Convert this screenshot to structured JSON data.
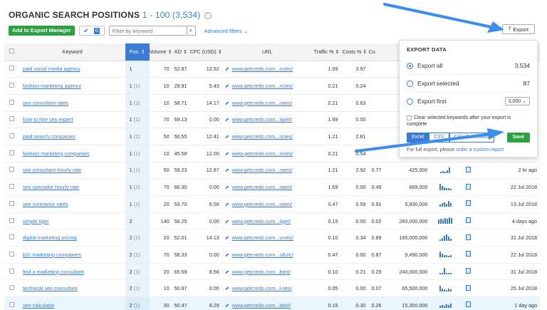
{
  "header": {
    "title": "ORGANIC SEARCH POSITIONS",
    "range": "1 - 100 (3,534)",
    "info_icon": "info-icon"
  },
  "toolbar": {
    "add_button": "Add to Export Manager",
    "check_count": "0",
    "filter_placeholder": "Filter by keyword",
    "advanced_filters": "Advanced filters"
  },
  "export_button": "Export",
  "columns": {
    "keyword": "Keyword",
    "pos": "Pos.",
    "volume": "Volume",
    "kd": "KD",
    "cpc": "CPC (USD)",
    "url": "URL",
    "traffic": "Traffic %",
    "costs": "Costs %",
    "com": "Co"
  },
  "rows": [
    {
      "keyword": "paid social media agency",
      "pos": "1",
      "prev": "",
      "volume": "70",
      "kd": "52.87",
      "cpc": "12.52",
      "url": "www.getcredo.com...ncies/",
      "traffic": "1.69",
      "costs": "3.97",
      "com": "",
      "results": "",
      "updated": "",
      "trend": []
    },
    {
      "keyword": "fashion marketing agency",
      "pos": "1",
      "prev": "(1)",
      "volume": "10",
      "kd": "29.91",
      "cpc": "5.43",
      "url": "www.getcredo.com...ncies/",
      "traffic": "0.21",
      "costs": "0.24",
      "com": "",
      "results": "",
      "updated": "",
      "trend": []
    },
    {
      "keyword": "seo consultant rates",
      "pos": "1",
      "prev": "(1)",
      "volume": "10",
      "kd": "58.71",
      "cpc": "14.17",
      "url": "www.getcredo.com...rates/",
      "traffic": "0.21",
      "costs": "0.63",
      "com": "",
      "results": "",
      "updated": "",
      "trend": []
    },
    {
      "keyword": "how to hire seo expert",
      "pos": "1",
      "prev": "(1)",
      "volume": "70",
      "kd": "69.13",
      "cpc": "0.00",
      "url": "www.getcredo.com...xpert/",
      "traffic": "1.69",
      "costs": "0.00",
      "com": "",
      "results": "",
      "updated": "",
      "trend": []
    },
    {
      "keyword": "paid search companies",
      "pos": "1",
      "prev": "(1)",
      "volume": "50",
      "kd": "50.55",
      "cpc": "12.41",
      "url": "www.getcredo.com...ncies/",
      "traffic": "1.21",
      "costs": "2.81",
      "com": "",
      "results": "",
      "updated": "",
      "trend": []
    },
    {
      "keyword": "fashion marketing companies",
      "pos": "1",
      "prev": "(1)",
      "volume": "10",
      "kd": "45.58",
      "cpc": "12.00",
      "url": "www.getcredo.com...ncies/",
      "traffic": "0.21",
      "costs": "0.54",
      "com": "",
      "results": "",
      "updated": "",
      "trend": []
    },
    {
      "keyword": "seo consultant hourly rate",
      "pos": "1",
      "prev": "(1)",
      "volume": "50",
      "kd": "59.23",
      "cpc": "12.87",
      "url": "www.getcredo.com...rates/",
      "traffic": "1.21",
      "costs": "2.92",
      "com": "0.77",
      "results": "425,000",
      "updated": "2 hr ago",
      "trend": [
        2,
        3,
        2,
        4,
        8
      ]
    },
    {
      "keyword": "seo specialist hourly rate",
      "pos": "1",
      "prev": "(1)",
      "volume": "70",
      "kd": "66.30",
      "cpc": "0.00",
      "url": "www.getcredo.com...rates/",
      "traffic": "1.69",
      "costs": "0.00",
      "com": "0.49",
      "results": "669,000",
      "updated": "22 Jul 2018",
      "trend": [
        9,
        6,
        4,
        3,
        3,
        2
      ]
    },
    {
      "keyword": "seo contractor rates",
      "pos": "1",
      "prev": "(1)",
      "volume": "20",
      "kd": "53.70",
      "cpc": "6.56",
      "url": "www.getcredo.com...rates/",
      "traffic": "0.47",
      "costs": "0.59",
      "com": "0.91",
      "results": "5,930,000",
      "updated": "13 Jul 2018",
      "trend": [
        3,
        5,
        6,
        4,
        8,
        5
      ]
    },
    {
      "keyword": "simple tiger",
      "pos": "2",
      "prev": "",
      "volume": "140",
      "kd": "56.25",
      "cpc": "0.00",
      "url": "www.getcredo.com...tiger/",
      "traffic": "0.15",
      "costs": "0.00",
      "com": "0.02",
      "results": "283,000,000",
      "updated": "4 days ago",
      "trend": [
        6,
        7,
        6,
        8,
        7,
        9,
        8
      ]
    },
    {
      "keyword": "digital marketing pricing",
      "pos": "2",
      "prev": "(1)",
      "volume": "20",
      "kd": "52.01",
      "cpc": "14.13",
      "url": "www.getcredo.com...urvey/",
      "traffic": "0.10",
      "costs": "0.34",
      "com": "0.89",
      "results": "165,000,000",
      "updated": "31 Jul 2018",
      "trend": [
        2,
        4,
        7,
        9,
        6,
        3
      ]
    },
    {
      "keyword": "b2c marketing companies",
      "pos": "2",
      "prev": "(1)",
      "volume": "70",
      "kd": "58.33",
      "cpc": "0.00",
      "url": "www.getcredo.com...s/b2c/",
      "traffic": "0.47",
      "costs": "0.00",
      "com": "0.87",
      "results": "9,490,000",
      "updated": "22 Jul 2018",
      "trend": [
        8,
        5,
        3,
        3,
        2,
        3
      ]
    },
    {
      "keyword": "find a marketing consultant",
      "pos": "2",
      "prev": "(1)",
      "volume": "20",
      "kd": "65.59",
      "cpc": "8.56",
      "url": "www.getcredo.com...ltant/",
      "traffic": "0.10",
      "costs": "0.21",
      "com": "0.29",
      "results": "240,000,000",
      "updated": "31 Jul 2018",
      "trend": [
        2,
        2,
        9,
        2,
        2,
        2
      ]
    },
    {
      "keyword": "technical seo consultant",
      "pos": "2",
      "prev": "(1)",
      "volume": "10",
      "kd": "50.87",
      "cpc": "0.00",
      "url": "www.getcredo.com...l-seo/",
      "traffic": "0.05",
      "costs": "0.00",
      "com": "0.07",
      "results": "65,500,000",
      "updated": "25 Jul 2018",
      "trend": [
        8,
        4,
        3,
        2,
        4,
        3
      ]
    },
    {
      "keyword": "seo calculator",
      "pos": "2",
      "prev": "(1)",
      "volume": "30",
      "kd": "50.47",
      "cpc": "8.29",
      "url": "www.getcredo.com...lator/",
      "traffic": "0.15",
      "costs": "0.30",
      "com": "0.26",
      "results": "15,300,000",
      "updated": "1 day ago",
      "trend": [
        3,
        4,
        3,
        5,
        4,
        6
      ]
    }
  ],
  "export_panel": {
    "heading": "EXPORT DATA",
    "export_all": "Export all",
    "export_all_count": "3,534",
    "export_selected": "Export selected",
    "export_selected_count": "87",
    "export_first": "Export first",
    "export_first_value": "3,000",
    "clear_label": "Clear selected keywords after your export is complete",
    "formats": [
      "Excel",
      "CSV",
      "CSV Semicolon"
    ],
    "save": "Save",
    "custom_prefix": "For full export, please ",
    "custom_link": "order a custom report"
  },
  "colors": {
    "accent": "#3a7bd5",
    "green": "#2ea043"
  },
  "icons": {
    "external": "external-link-icon",
    "serp": "serp-snapshot-icon",
    "search": "search-icon",
    "upload": "upload-icon",
    "chevron": "chevron-down-icon"
  }
}
